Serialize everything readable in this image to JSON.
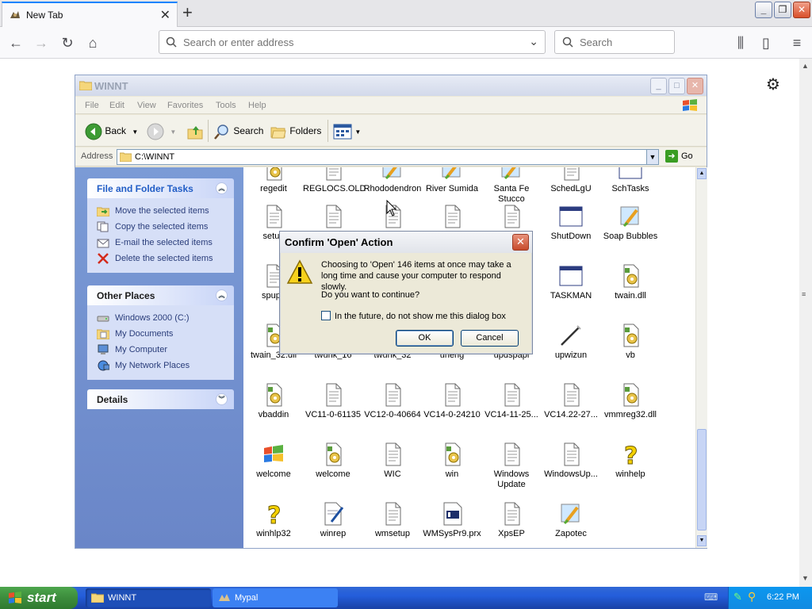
{
  "browser": {
    "tab_title": "New Tab",
    "url_placeholder": "Search or enter address",
    "search_placeholder": "Search"
  },
  "explorer": {
    "title": "WINNT",
    "menu": [
      "File",
      "Edit",
      "View",
      "Favorites",
      "Tools",
      "Help"
    ],
    "toolbar": {
      "back": "Back",
      "search": "Search",
      "folders": "Folders"
    },
    "address_label": "Address",
    "address_value": "C:\\WINNT",
    "go_label": "Go",
    "panels": {
      "tasks": {
        "title": "File and Folder Tasks",
        "items": [
          "Move the selected items",
          "Copy the selected items",
          "E-mail the selected items",
          "Delete the selected items"
        ]
      },
      "places": {
        "title": "Other Places",
        "items": [
          "Windows 2000 (C:)",
          "My Documents",
          "My Computer",
          "My Network Places"
        ]
      },
      "details": {
        "title": "Details"
      }
    },
    "files": [
      [
        "regedit",
        "REGLOCS.OLD",
        "Rhododendron",
        "River Sumida",
        "Santa Fe Stucco",
        "SchedLgU",
        "SchTasks"
      ],
      [
        "setup",
        "",
        "",
        "",
        "",
        "ShutDown",
        "Soap Bubbles"
      ],
      [
        "spupd",
        "",
        "",
        "",
        "",
        "TASKMAN",
        "twain.dll"
      ],
      [
        "twain_32.dll",
        "twunk_16",
        "twunk_32",
        "uneng",
        "updspapi",
        "upwizun",
        "vb"
      ],
      [
        "vbaddin",
        "VC11-0-61135",
        "VC12-0-40664",
        "VC14-0-24210",
        "VC14-11-25...",
        "VC14.22-27...",
        "vmmreg32.dll"
      ],
      [
        "welcome",
        "welcome",
        "WIC",
        "win",
        "Windows Update",
        "WindowsUp...",
        "winhelp"
      ],
      [
        "winhlp32",
        "winrep",
        "wmsetup",
        "WMSysPr9.prx",
        "XpsEP",
        "Zapotec",
        ""
      ]
    ]
  },
  "dialog": {
    "title": "Confirm 'Open' Action",
    "message": "Choosing to 'Open' 146 items at once may take a long time and cause your computer to respond slowly.",
    "question": "Do you want to continue?",
    "checkbox_label": "In the future, do not show me this dialog box",
    "ok": "OK",
    "cancel": "Cancel"
  },
  "taskbar": {
    "start": "start",
    "tasks": [
      "WINNT",
      "Mypal"
    ],
    "clock": "6:22 PM"
  },
  "colors": {
    "xp_blue": "#245edb",
    "start_green": "#3c8c3c",
    "panel_blue": "#215dc6"
  }
}
